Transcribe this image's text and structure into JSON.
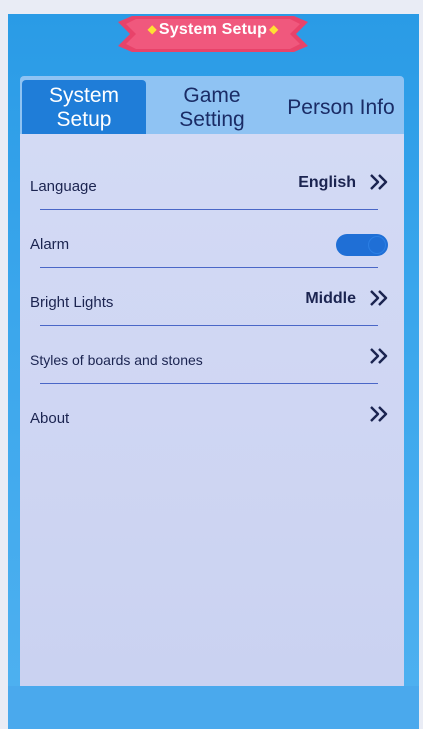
{
  "title": "System Setup",
  "tabs": [
    {
      "label_line1": "System",
      "label_line2": "Setup",
      "active": true
    },
    {
      "label_line1": "Game",
      "label_line2": "Setting",
      "active": false
    },
    {
      "label": "Person Info",
      "active": false
    }
  ],
  "settings": {
    "language": {
      "label": "Language",
      "value": "English"
    },
    "alarm": {
      "label": "Alarm",
      "state": "on"
    },
    "bright_lights": {
      "label": "Bright Lights",
      "value": "Middle"
    },
    "styles": {
      "label": "Styles of boards and stones"
    },
    "about": {
      "label": "About"
    }
  },
  "colors": {
    "screen_bg": "#2a9be6",
    "active_tab": "#1f7dd8",
    "panel_bg": "#d3daf4",
    "banner": "#e8436a",
    "banner_diamond": "#ffe033",
    "toggle_on": "#1f6fd6"
  },
  "icons": {
    "chevron": "double-chevron-right-icon",
    "banner_ornament": "diamond-icon"
  }
}
